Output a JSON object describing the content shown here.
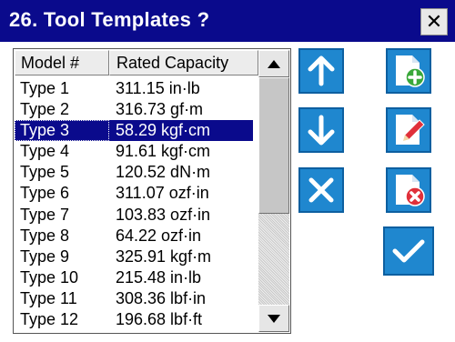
{
  "window": {
    "title": "26. Tool Templates ?",
    "close_label": "✕"
  },
  "table": {
    "columns": [
      "Model #",
      "Rated Capacity"
    ],
    "selected_index": 2,
    "rows": [
      {
        "model": "Type 1",
        "capacity": "311.15 in·lb"
      },
      {
        "model": "Type 2",
        "capacity": "316.73 gf·m"
      },
      {
        "model": "Type 3",
        "capacity": "58.29 kgf·cm"
      },
      {
        "model": "Type 4",
        "capacity": "91.61 kgf·cm"
      },
      {
        "model": "Type 5",
        "capacity": "120.52 dN·m"
      },
      {
        "model": "Type 6",
        "capacity": "311.07 ozf·in"
      },
      {
        "model": "Type 7",
        "capacity": "103.83 ozf·in"
      },
      {
        "model": "Type 8",
        "capacity": "64.22 ozf·in"
      },
      {
        "model": "Type 9",
        "capacity": "325.91 kgf·m"
      },
      {
        "model": "Type 10",
        "capacity": "215.48 in·lb"
      },
      {
        "model": "Type 11",
        "capacity": "308.36 lbf·in"
      },
      {
        "model": "Type 12",
        "capacity": "196.68 lbf·ft"
      }
    ]
  },
  "actions": {
    "move_up": "arrow-up-icon",
    "move_down": "arrow-down-icon",
    "delete": "x-icon",
    "add": "document-add-icon",
    "edit": "document-edit-icon",
    "remove": "document-remove-icon",
    "confirm": "checkmark-icon"
  },
  "colors": {
    "titlebar": "#0a0a8c",
    "button_blue": "#1f87cf",
    "selection": "#0a0a8c",
    "add_green": "#3aa83a",
    "edit_red": "#e0303a"
  }
}
